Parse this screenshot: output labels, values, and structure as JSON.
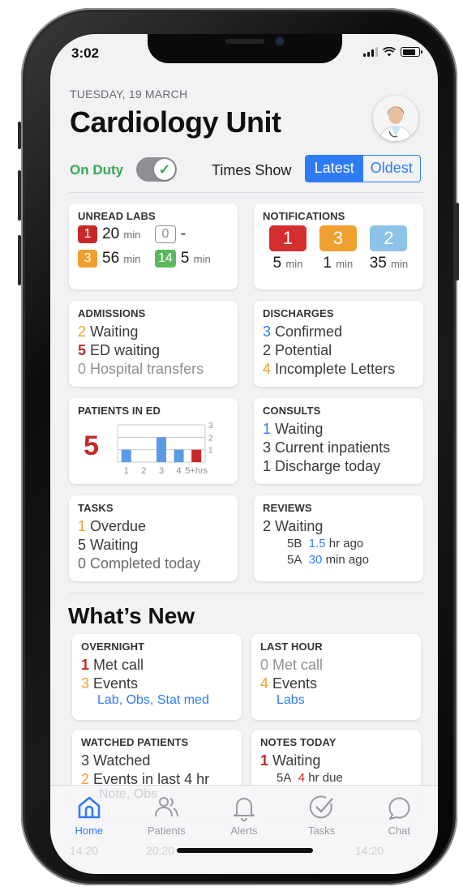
{
  "status_bar": {
    "time": "3:02"
  },
  "header": {
    "date": "TUESDAY, 19 MARCH",
    "title": "Cardiology Unit"
  },
  "controls": {
    "on_duty_label": "On Duty",
    "on_duty": true,
    "times_show_label": "Times Show",
    "segments": [
      "Latest",
      "Oldest"
    ],
    "selected_segment": "Latest"
  },
  "unread_labs": {
    "title": "UNREAD LABS",
    "items": [
      {
        "count": "1",
        "color": "#c62828",
        "time": "20",
        "unit": "min"
      },
      {
        "count": "0",
        "color": "outline",
        "time": "-",
        "unit": ""
      },
      {
        "count": "3",
        "color": "#f0a030",
        "time": "56",
        "unit": "min"
      },
      {
        "count": "14",
        "color": "#5cb85c",
        "time": "5",
        "unit": "min"
      }
    ]
  },
  "notifications": {
    "title": "NOTIFICATIONS",
    "items": [
      {
        "count": "1",
        "color": "#d32f2f",
        "time": "5",
        "unit": "min"
      },
      {
        "count": "3",
        "color": "#f0a030",
        "time": "1",
        "unit": "min"
      },
      {
        "count": "2",
        "color": "#8ec3e8",
        "time": "35",
        "unit": "min"
      }
    ]
  },
  "admissions": {
    "title": "ADMISSIONS",
    "lines": [
      {
        "n": "2",
        "text": "Waiting"
      },
      {
        "n": "5",
        "text": "ED waiting"
      },
      {
        "n": "0",
        "text": "Hospital transfers"
      }
    ]
  },
  "discharges": {
    "title": "DISCHARGES",
    "lines": [
      {
        "n": "3",
        "text": "Confirmed"
      },
      {
        "n": "2",
        "text": "Potential"
      },
      {
        "n": "4",
        "text": "Incomplete Letters"
      }
    ]
  },
  "patients_in_ed": {
    "title": "PATIENTS IN ED",
    "total": "5"
  },
  "chart_data": {
    "type": "bar",
    "categories": [
      "1",
      "2",
      "3",
      "4",
      "5+hrs"
    ],
    "values": [
      1,
      0,
      2,
      1,
      1
    ],
    "colors": [
      "#5b9be6",
      "#5b9be6",
      "#5b9be6",
      "#5b9be6",
      "#c62828"
    ],
    "y_ticks": [
      "3",
      "2",
      "1"
    ],
    "ylim": [
      0,
      3
    ]
  },
  "consults": {
    "title": "CONSULTS",
    "lines": [
      {
        "n": "1",
        "text": "Waiting"
      },
      {
        "n": "3",
        "text": "Current inpatients"
      },
      {
        "n": "1",
        "text": "Discharge today"
      }
    ]
  },
  "tasks": {
    "title": "TASKS",
    "lines": [
      {
        "n": "1",
        "text": "Overdue"
      },
      {
        "n": "5",
        "text": "Waiting"
      },
      {
        "n": "0",
        "text": "Completed today"
      }
    ]
  },
  "reviews": {
    "title": "REVIEWS",
    "waiting_n": "2",
    "waiting_text": "Waiting",
    "items": [
      {
        "bed": "5B",
        "ago_n": "1.5",
        "ago_text": "hr ago"
      },
      {
        "bed": "5A",
        "ago_n": "30",
        "ago_text": "min ago"
      }
    ]
  },
  "whats_new": {
    "title": "What’s New"
  },
  "overnight": {
    "title": "OVERNIGHT",
    "lines": [
      {
        "n": "1",
        "text": "Met call"
      },
      {
        "n": "3",
        "text": "Events"
      }
    ],
    "link": "Lab, Obs, Stat med"
  },
  "last_hour": {
    "title": "LAST HOUR",
    "lines": [
      {
        "n": "0",
        "text": "Met call"
      },
      {
        "n": "4",
        "text": "Events"
      }
    ],
    "link": "Labs"
  },
  "watched": {
    "title": "WATCHED PATIENTS",
    "lines": [
      {
        "n": "3",
        "text": "Watched"
      },
      {
        "n": "2",
        "text": "Events in last 4 hr"
      }
    ],
    "ghost": "Note, Obs"
  },
  "notes_today": {
    "title": "NOTES TODAY",
    "lines": [
      {
        "n": "1",
        "text": "Waiting"
      }
    ],
    "sub_bed": "5A",
    "sub_n": "4",
    "sub_text": "hr due"
  },
  "ghost_times": [
    "14:20",
    "20:20",
    "14:20"
  ],
  "tabbar": {
    "tabs": [
      {
        "label": "Home",
        "icon": "home-icon",
        "active": true
      },
      {
        "label": "Patients",
        "icon": "patients-icon",
        "active": false
      },
      {
        "label": "Alerts",
        "icon": "bell-icon",
        "active": false
      },
      {
        "label": "Tasks",
        "icon": "check-circle-icon",
        "active": false
      },
      {
        "label": "Chat",
        "icon": "chat-icon",
        "active": false
      }
    ]
  }
}
